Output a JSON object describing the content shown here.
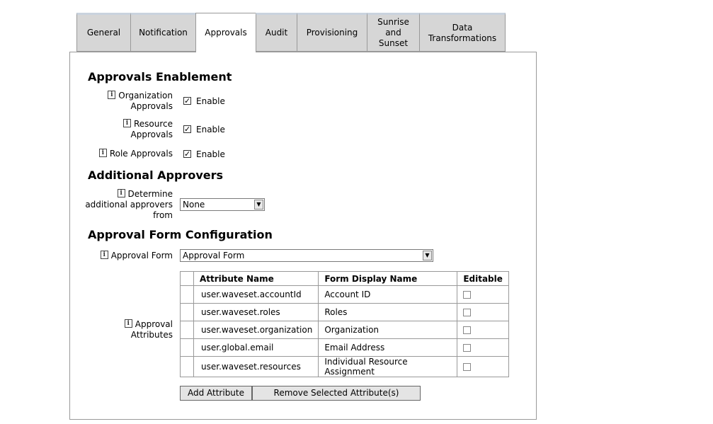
{
  "tabs": [
    {
      "label": "General"
    },
    {
      "label": "Notification"
    },
    {
      "label": "Approvals"
    },
    {
      "label": "Audit"
    },
    {
      "label": "Provisioning"
    },
    {
      "label": "Sunrise\nand\nSunset"
    },
    {
      "label": "Data\nTransformations"
    }
  ],
  "sections": {
    "enablement": "Approvals Enablement",
    "additional": "Additional Approvers",
    "form_config": "Approval Form Configuration"
  },
  "enablement": {
    "org_label": "Organization\nApprovals",
    "res_label": "Resource\nApprovals",
    "role_label": "Role Approvals",
    "enable_text": "Enable"
  },
  "additional": {
    "label": "Determine\nadditional approvers\nfrom",
    "value": "None"
  },
  "form": {
    "label": "Approval Form",
    "value": "Approval Form",
    "attrs_label": "Approval Attributes"
  },
  "table": {
    "headers": [
      "Attribute Name",
      "Form Display Name",
      "Editable"
    ],
    "rows": [
      {
        "attr": "user.waveset.accountId",
        "display": "Account ID"
      },
      {
        "attr": "user.waveset.roles",
        "display": "Roles"
      },
      {
        "attr": "user.waveset.organization",
        "display": "Organization"
      },
      {
        "attr": "user.global.email",
        "display": "Email Address"
      },
      {
        "attr": "user.waveset.resources",
        "display": "Individual Resource Assignment"
      }
    ]
  },
  "buttons": {
    "add": "Add Attribute",
    "remove": "Remove Selected Attribute(s)"
  }
}
